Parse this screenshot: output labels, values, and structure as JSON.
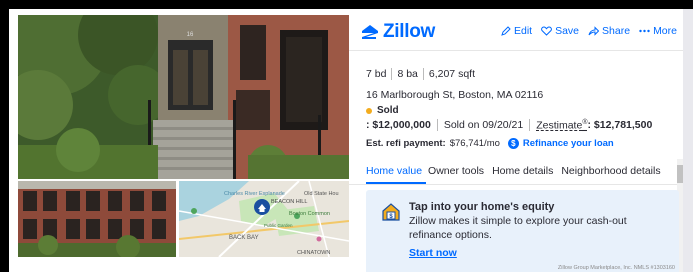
{
  "header": {
    "logo_text": "Zillow",
    "actions": {
      "edit": "Edit",
      "save": "Save",
      "share": "Share",
      "more": "More"
    }
  },
  "facts": {
    "beds": "7 bd",
    "baths": "8 ba",
    "sqft": "6,207 sqft"
  },
  "address": "16 Marlborough St, Boston, MA 02116",
  "status": {
    "label": "Sold"
  },
  "price": {
    "sold_price": ": $12,000,000",
    "sold_date": "Sold on 09/20/21",
    "zestimate_label": "Zestimate",
    "zestimate_sup": "®",
    "zestimate_value": ": $12,781,500"
  },
  "payment": {
    "label": "Est. refi payment:",
    "value": "$76,741/mo",
    "refi_link": "Refinance your loan"
  },
  "tabs": [
    {
      "label": "Home value"
    },
    {
      "label": "Owner tools"
    },
    {
      "label": "Home details"
    },
    {
      "label": "Neighborhood details"
    }
  ],
  "equity": {
    "title": "Tap into your home's equity",
    "body": "Zillow makes it simple to explore your cash-out refinance options.",
    "link": "Start now",
    "fine_print": "Zillow Group Marketplace, Inc. NMLS #1303160"
  },
  "map": {
    "labels": [
      "Charles River Esplanade",
      "Old State Hou",
      "BEACON HILL",
      "Boston Common",
      "BACK BAY",
      "CHINATOWN",
      "Public Garden"
    ]
  },
  "house_number": "16",
  "colors": {
    "accent": "#006aff",
    "status_dot": "#f3ac1e",
    "equity_bg": "#e8f1fb"
  }
}
